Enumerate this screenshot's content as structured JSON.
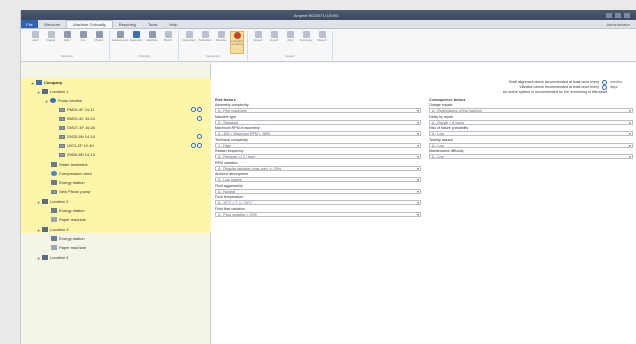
{
  "window": {
    "title": "Ampere BOGETU LEVEL"
  },
  "menubar": {
    "file_label": "File",
    "tabs": [
      "Structure",
      "Machine Criticality",
      "Reporting",
      "Tools",
      "Help"
    ],
    "user": "Administrator"
  },
  "ribbon": {
    "groups": [
      {
        "label": "Structure",
        "buttons": [
          "Add",
          "Delete",
          "Edit",
          "Cut",
          "Paste"
        ]
      },
      {
        "label": "Criticality",
        "buttons": [
          "Assessment",
          "Assembly",
          "Machine",
          "Batch"
        ]
      },
      {
        "label": "Inspection",
        "buttons": [
          "Inspection",
          "Schedule",
          "Results",
          "Criticality Analysis"
        ]
      },
      {
        "label": "Export",
        "buttons": [
          "Export",
          "Import",
          "Add",
          "Summary",
          "Report"
        ]
      }
    ]
  },
  "tree": {
    "nodes": [
      {
        "label": "Company",
        "level": 0,
        "icon": "company-icon"
      },
      {
        "label": "Location 1",
        "level": 1,
        "icon": "location-icon"
      },
      {
        "label": "Pump section",
        "level": 2,
        "icon": "pump-icon"
      },
      {
        "label": "PM25-4F 24-11",
        "level": 3,
        "icon": "measurement-icon"
      },
      {
        "label": "BM25-4C 15-10",
        "level": 3,
        "icon": "measurement-icon"
      },
      {
        "label": "GM27-4F 16-40",
        "level": 3,
        "icon": "measurement-icon"
      },
      {
        "label": "ZM25-8N 14-10",
        "level": 3,
        "icon": "measurement-icon"
      },
      {
        "label": "LB74-2F 10-40",
        "level": 3,
        "icon": "measurement-icon"
      },
      {
        "label": "ZM25-8N 14-10",
        "level": 3,
        "icon": "measurement-icon"
      },
      {
        "label": "Water treatment",
        "level": 2,
        "icon": "machine-icon"
      },
      {
        "label": "Compression area",
        "level": 2,
        "icon": "compressor-icon"
      },
      {
        "label": "Energy station",
        "level": 2,
        "icon": "machine-icon"
      },
      {
        "label": "New Piston pump",
        "level": 2,
        "icon": "measurement-icon"
      },
      {
        "label": "Location 2",
        "level": 1,
        "icon": "location-icon"
      },
      {
        "label": "Energy station",
        "level": 2,
        "icon": "machine-icon"
      },
      {
        "label": "Paper machine",
        "level": 2,
        "icon": "paper-icon"
      },
      {
        "label": "Location 3",
        "level": 1,
        "icon": "location-icon"
      },
      {
        "label": "Energy station",
        "level": 2,
        "icon": "machine-icon"
      },
      {
        "label": "Paper machine",
        "level": 2,
        "icon": "paper-icon"
      },
      {
        "label": "Location 4",
        "level": 1,
        "icon": "location-icon"
      }
    ]
  },
  "info": {
    "lines": [
      {
        "text": "Shaft alignment check recommended at least once every",
        "value": "months"
      },
      {
        "text": "Vibration check recommended at least once every",
        "value": "days"
      },
      {
        "text": "An online system is recommended for the monitoring of this asset",
        "value": ""
      }
    ]
  },
  "risk_factors": {
    "heading": "Risk factors",
    "fields": [
      {
        "label": "Assembly complexity",
        "value": "A - Fine machines"
      },
      {
        "label": "Machine type",
        "value": "A - Standard"
      },
      {
        "label": "Maximum RPM of assembly",
        "value": "A - 300 < Maximum RPM < 1800"
      },
      {
        "label": "Technical complexity",
        "value": "1 - High"
      },
      {
        "label": "Restart frequency",
        "value": "A - Restarts <= 1 / hour"
      },
      {
        "label": "RPM variation",
        "value": "A - Regular variation (max-min) <= 20%"
      },
      {
        "label": "Ambient atmosphere",
        "value": "A - Low loaded"
      },
      {
        "label": "Fluid aggressivity",
        "value": "A - Neutral"
      },
      {
        "label": "Fluid temperature",
        "value": "A - 20°C < T <= 70°C"
      },
      {
        "label": "Fluid flow variation",
        "value": "A - Flow variation < 10%"
      }
    ]
  },
  "consequence_factors": {
    "heading": "Consequence factors",
    "fields": [
      {
        "label": "Outage impact",
        "value": "A - Redundancy of the machine"
      },
      {
        "label": "Delay by repair",
        "value": "A - Repair < 8 hours"
      },
      {
        "label": "Risk of failure probability",
        "value": "A - Low"
      },
      {
        "label": "Toxicity hazard",
        "value": "A - Low"
      },
      {
        "label": "Maintenance difficulty",
        "value": "A - Low"
      }
    ]
  },
  "colors": {
    "accent": "#2e63b5",
    "selection": "#fdf5a8",
    "status_ring": "#2e6bb5"
  }
}
